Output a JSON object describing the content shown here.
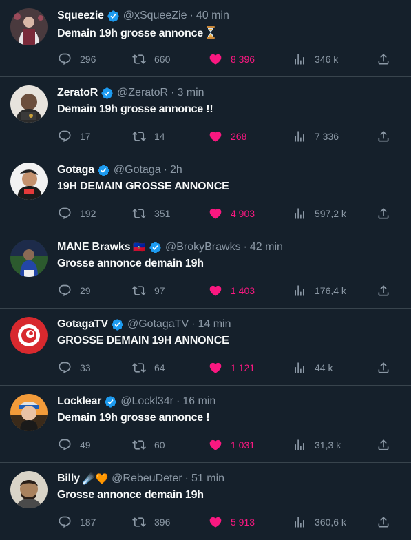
{
  "tweets": [
    {
      "name": "Squeezie",
      "handle": "@xSqueeZie",
      "time": "40 min",
      "text": "Demain 19h grosse annonce",
      "trailing_emoji": "hourglass",
      "replies": "296",
      "retweets": "660",
      "likes": "8 396",
      "views": "346 k",
      "verified": true,
      "liked": true
    },
    {
      "name": "ZeratoR",
      "handle": "@ZeratoR",
      "time": "3 min",
      "text": "Demain 19h grosse annonce !!",
      "replies": "17",
      "retweets": "14",
      "likes": "268",
      "views": "7 336",
      "verified": true,
      "liked": true
    },
    {
      "name": "Gotaga",
      "handle": "@Gotaga",
      "time": "2h",
      "text": "19H DEMAIN GROSSE ANNONCE",
      "replies": "192",
      "retweets": "351",
      "likes": "4 903",
      "views": "597,2 k",
      "verified": true,
      "liked": true
    },
    {
      "name": "MANE Brawks",
      "handle": "@BrokyBrawks",
      "time": "42 min",
      "text": "Grosse annonce demain 19h",
      "name_emoji": "🇭🇹",
      "replies": "29",
      "retweets": "97",
      "likes": "1 403",
      "views": "176,4 k",
      "verified": true,
      "liked": true
    },
    {
      "name": "GotagaTV",
      "handle": "@GotagaTV",
      "time": "14 min",
      "text": "GROSSE DEMAIN 19H ANNONCE",
      "replies": "33",
      "retweets": "64",
      "likes": "1 121",
      "views": "44 k",
      "verified": true,
      "liked": true
    },
    {
      "name": "Locklear",
      "handle": "@Lockl34r",
      "time": "16 min",
      "text": "Demain 19h grosse annonce !",
      "replies": "49",
      "retweets": "60",
      "likes": "1 031",
      "views": "31,3 k",
      "verified": true,
      "liked": true
    },
    {
      "name": "Billy",
      "handle": "@RebeuDeter",
      "time": "51 min",
      "text": "Grosse annonce demain 19h",
      "name_emoji": "☄️🧡",
      "replies": "187",
      "retweets": "396",
      "likes": "5 913",
      "views": "360,6 k",
      "verified": false,
      "liked": true
    }
  ],
  "colors": {
    "background": "#15202b",
    "divider": "#38444d",
    "secondary_text": "#8b98a5",
    "like": "#f91880",
    "verified": "#1d9bf0"
  },
  "icons": {
    "reply": "reply-icon",
    "retweet": "retweet-icon",
    "like": "heart-icon",
    "views": "views-icon",
    "share": "share-icon",
    "verified": "verified-badge-icon"
  }
}
